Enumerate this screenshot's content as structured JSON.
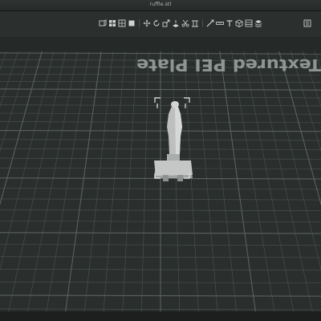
{
  "window": {
    "title": "ruffle.stl"
  },
  "toolbar": {
    "icons": [
      "add-object-icon",
      "arrange-icon",
      "orient-icon",
      "grid-icon",
      "move-icon",
      "rotate-icon",
      "scale-icon",
      "place-on-face-icon",
      "cut-icon",
      "supports-icon",
      "seam-icon",
      "measure-icon",
      "text-icon",
      "view-3d-icon",
      "slice-icon",
      "layers-icon"
    ]
  },
  "plate": {
    "label": "Textured PEI Plate"
  },
  "colors": {
    "bed_background": "#262a28",
    "grid_line": "#4a4f4c",
    "model": "#b5b8b7",
    "selection_bracket": "#e6e6e6"
  }
}
